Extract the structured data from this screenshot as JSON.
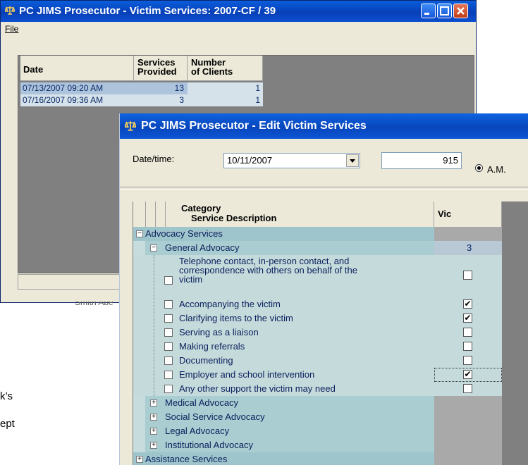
{
  "window_main": {
    "title": "PC JIMS Prosecutor - Victim Services: 2007-CF / 39",
    "menu_file": "File",
    "grid": {
      "col_date": "Date",
      "col_services_1": "Services",
      "col_services_2": "Provided",
      "col_clients_1": "Number",
      "col_clients_2": "of Clients",
      "rows": [
        {
          "date": "07/13/2007 09:20 AM",
          "services": "13",
          "clients": "1"
        },
        {
          "date": "07/16/2007 09:36 AM",
          "services": "3",
          "clients": "1"
        }
      ]
    },
    "behind_text": "Smith Abe"
  },
  "window_edit": {
    "title": "PC JIMS Prosecutor - Edit Victim Services",
    "date_label": "Date/time:",
    "date_value": "10/11/2007",
    "time_value": "915",
    "ampm_label": "A.M.",
    "col_category": "Category",
    "col_service": "Service Description",
    "col_vic": "Vic",
    "rows": [
      {
        "text": "Advocacy Services",
        "level": 0,
        "toggle": "−"
      },
      {
        "text": "General Advocacy",
        "level": 1,
        "toggle": "−",
        "vic": "3"
      },
      {
        "text_lines": [
          "Telephone contact, in-person contact, and",
          "correspondence with others on behalf of the",
          "victim"
        ],
        "level": 2,
        "checked": false
      },
      {
        "text": "Accompanying the victim",
        "level": 2,
        "checked": true
      },
      {
        "text": "Clarifying items to the victim",
        "level": 2,
        "checked": true
      },
      {
        "text": "Serving as a liaison",
        "level": 2,
        "checked": false
      },
      {
        "text": "Making referrals",
        "level": 2,
        "checked": false
      },
      {
        "text": "Documenting",
        "level": 2,
        "checked": false
      },
      {
        "text": "Employer and school intervention",
        "level": 2,
        "checked": true
      },
      {
        "text": "Any other support the victim may need",
        "level": 2,
        "checked": false
      },
      {
        "text": "Medical Advocacy",
        "level": 1,
        "toggle": "+"
      },
      {
        "text": "Social Service Advocacy",
        "level": 1,
        "toggle": "+"
      },
      {
        "text": "Legal Advocacy",
        "level": 1,
        "toggle": "+"
      },
      {
        "text": "Institutional Advocacy",
        "level": 1,
        "toggle": "+"
      },
      {
        "text": "Assistance Services",
        "level": 0,
        "toggle": "+"
      }
    ]
  },
  "page_fragments": {
    "frag_1": "k’s",
    "frag_2": "ept"
  },
  "colors": {
    "titlebar": "#0a4fd0",
    "tree_bg": "#c4dadb",
    "vic_bg": "#a9a9a9"
  }
}
